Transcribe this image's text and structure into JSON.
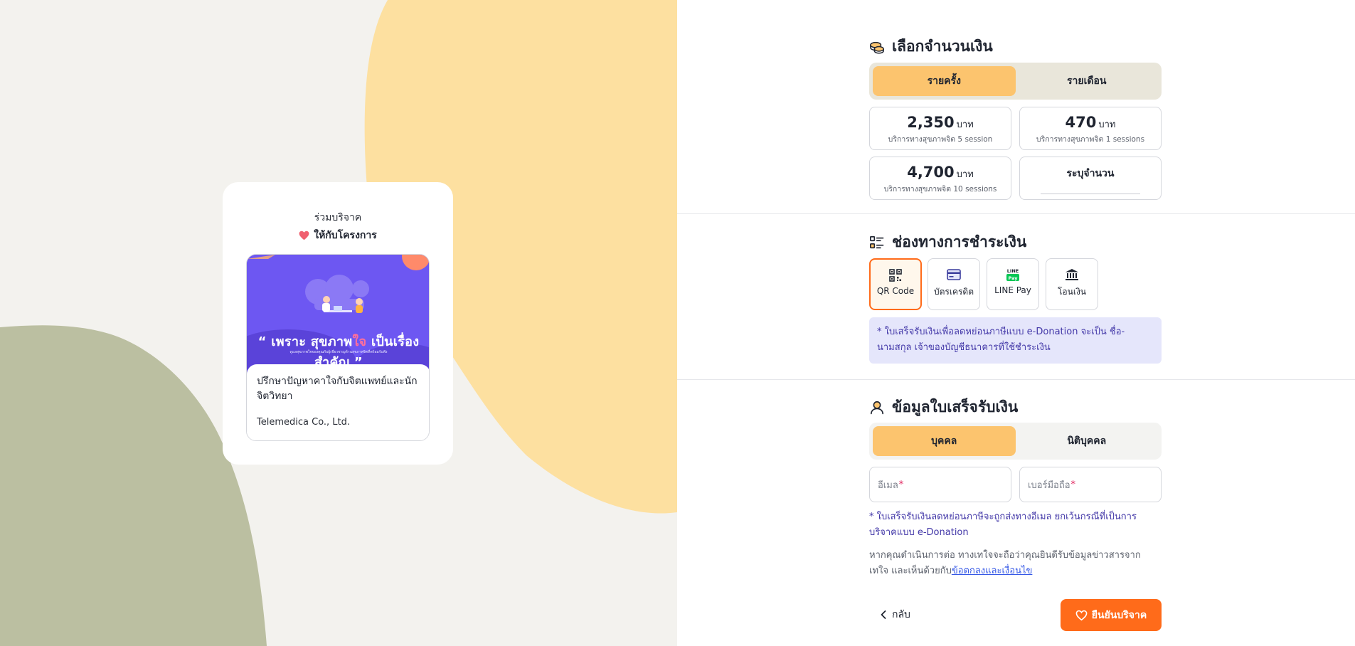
{
  "left": {
    "join_label": "ร่วมบริจาค",
    "give_label": "ให้กับโครงการ",
    "banner": {
      "quote_prefix": "“ เพราะ ",
      "quote_main": "สุขภาพ",
      "quote_accent": "ใจ",
      "quote_suffix": " เป็นเรื่องสำคัญ ”",
      "subtext": "ดูแลสุขภาพใจของคุณกับผู้เชี่ยวชาญด้านสุขภาพจิตที่พร้อมรับฟัง"
    },
    "project_title": "ปรึกษาปัญหาคาใจกับจิตแพทย์และนักจิตวิทยา",
    "project_org": "Telemedica Co., Ltd."
  },
  "amount_section": {
    "heading": "เลือกจำนวนเงิน",
    "icon": "coins-icon",
    "tabs": [
      {
        "label": "รายครั้ง",
        "active": true
      },
      {
        "label": "รายเดือน",
        "active": false
      }
    ],
    "options": [
      {
        "value": "2,350",
        "unit": "บาท",
        "desc": "บริการทางสุขภาพจิต 5 session"
      },
      {
        "value": "470",
        "unit": "บาท",
        "desc": "บริการทางสุขภาพจิต 1 sessions"
      },
      {
        "value": "4,700",
        "unit": "บาท",
        "desc": "บริการทางสุขภาพจิต 10 sessions"
      }
    ],
    "custom_label": "ระบุจำนวน"
  },
  "payment_section": {
    "heading": "ช่องทางการชำระเงิน",
    "icon": "list-icon",
    "methods": [
      {
        "label": "QR Code",
        "icon": "qr-code-icon",
        "active": true
      },
      {
        "label": "บัตรเครดิต",
        "icon": "credit-card-icon",
        "active": false
      },
      {
        "label": "LINE Pay",
        "icon": "line-pay-icon",
        "active": false
      },
      {
        "label": "โอนเงิน",
        "icon": "bank-icon",
        "active": false
      }
    ],
    "note": "* ใบเสร็จรับเงินเพื่อลดหย่อนภาษีแบบ e-Donation จะเป็น ชื่อ-นามสกุล เจ้าของบัญชีธนาคารที่ใช้ชำระเงิน"
  },
  "receipt_section": {
    "heading": "ข้อมูลใบเสร็จรับเงิน",
    "icon": "user-icon",
    "tabs": [
      {
        "label": "บุคคล",
        "active": true
      },
      {
        "label": "นิติบุคคล",
        "active": false
      }
    ],
    "email_placeholder": "อีเมล",
    "phone_placeholder": "เบอร์มือถือ",
    "required_mark": "*",
    "note": "* ใบเสร็จรับเงินลดหย่อนภาษีจะถูกส่งทางอีเมล ยกเว้นกรณีที่เป็นการบริจาคแบบ e-Donation",
    "consent_text": "หากคุณดำเนินการต่อ ทางเทใจจะถือว่าคุณยินดีรับข้อมูลข่าวสารจาก เทใจ และเห็นด้วยกับ",
    "consent_link": "ข้อตกลงและเงื่อนไข"
  },
  "actions": {
    "back_label": "กลับ",
    "confirm_label": "ยืนยันบริจาค"
  },
  "colors": {
    "accent_orange": "#ff6b1a",
    "tab_active": "#fcc46e",
    "note_text": "#4338a8",
    "note_bg": "#e5e6fb",
    "banner_purple": "#6d57f2"
  }
}
